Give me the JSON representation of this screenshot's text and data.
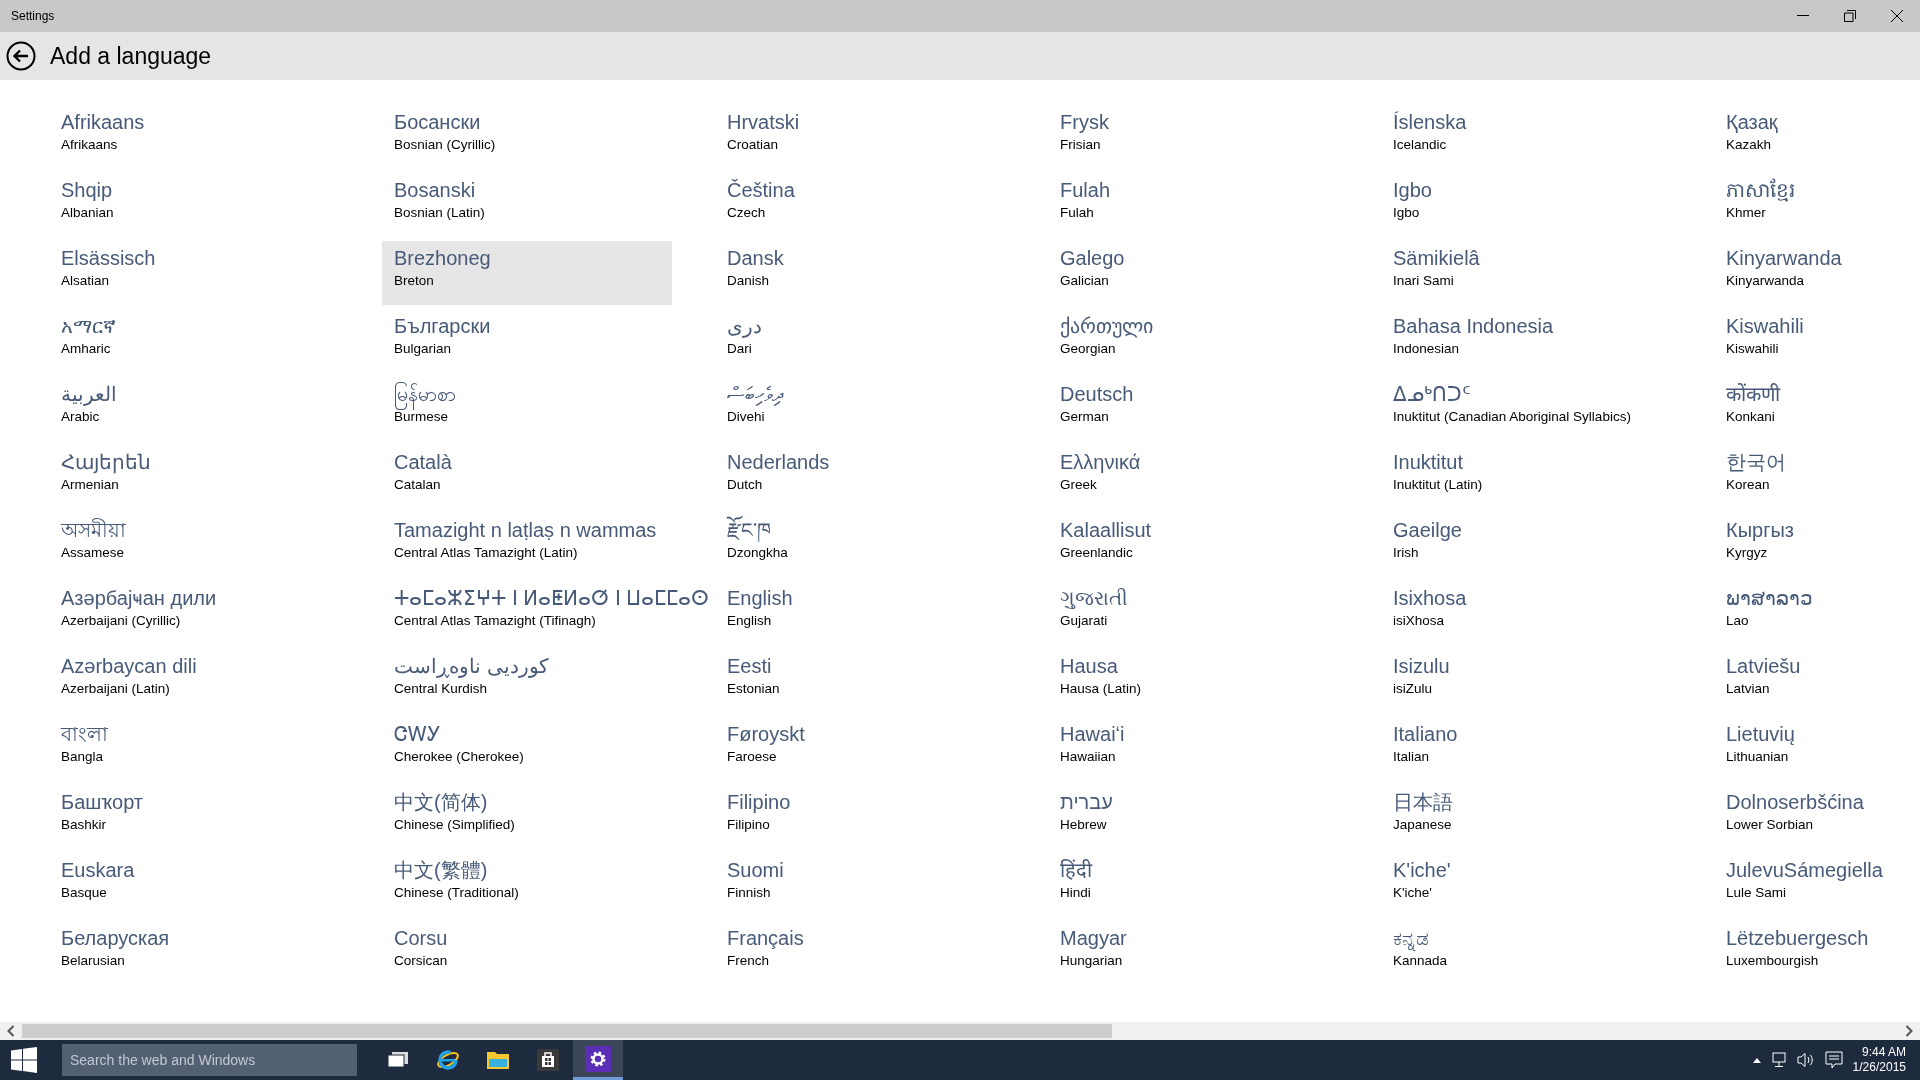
{
  "window": {
    "title": "Settings"
  },
  "page": {
    "title": "Add a language"
  },
  "languages": [
    {
      "native": "Afrikaans",
      "english": "Afrikaans",
      "selected": false
    },
    {
      "native": "Shqip",
      "english": "Albanian",
      "selected": false
    },
    {
      "native": "Elsässisch",
      "english": "Alsatian",
      "selected": false
    },
    {
      "native": "አማርኛ",
      "english": "Amharic",
      "selected": false
    },
    {
      "native": "العربية",
      "english": "Arabic",
      "selected": false
    },
    {
      "native": "Հայերեն",
      "english": "Armenian",
      "selected": false
    },
    {
      "native": "অসমীয়া",
      "english": "Assamese",
      "selected": false
    },
    {
      "native": "Азәрбајҹан дили",
      "english": "Azerbaijani (Cyrillic)",
      "selected": false
    },
    {
      "native": "Azərbaycan dili",
      "english": "Azerbaijani (Latin)",
      "selected": false
    },
    {
      "native": "বাংলা",
      "english": "Bangla",
      "selected": false
    },
    {
      "native": "Башҡорт",
      "english": "Bashkir",
      "selected": false
    },
    {
      "native": "Euskara",
      "english": "Basque",
      "selected": false
    },
    {
      "native": "Беларуская",
      "english": "Belarusian",
      "selected": false
    },
    {
      "native": "Босански",
      "english": "Bosnian (Cyrillic)",
      "selected": false
    },
    {
      "native": "Bosanski",
      "english": "Bosnian (Latin)",
      "selected": false
    },
    {
      "native": "Brezhoneg",
      "english": "Breton",
      "selected": true
    },
    {
      "native": "Български",
      "english": "Bulgarian",
      "selected": false
    },
    {
      "native": "မြန်မာစာ",
      "english": "Burmese",
      "selected": false
    },
    {
      "native": "Català",
      "english": "Catalan",
      "selected": false
    },
    {
      "native": "Tamazight n laṭlaṣ n wammas",
      "english": "Central Atlas Tamazight (Latin)",
      "selected": false
    },
    {
      "native": "ⵜⴰⵎⴰⵣⵉⵖⵜ ⵏ ⵍⴰⵟⵍⴰⵚ ⵏ ⵡⴰⵎⵎⴰⵙ",
      "english": "Central Atlas Tamazight (Tifinagh)",
      "selected": false
    },
    {
      "native": "کوردیی ناوەڕاست",
      "english": "Central Kurdish",
      "selected": false
    },
    {
      "native": "ᏣᎳᎩ",
      "english": "Cherokee (Cherokee)",
      "selected": false
    },
    {
      "native": "中文(简体)",
      "english": "Chinese (Simplified)",
      "selected": false
    },
    {
      "native": "中文(繁體)",
      "english": "Chinese (Traditional)",
      "selected": false
    },
    {
      "native": "Corsu",
      "english": "Corsican",
      "selected": false
    },
    {
      "native": "Hrvatski",
      "english": "Croatian",
      "selected": false
    },
    {
      "native": "Čeština",
      "english": "Czech",
      "selected": false
    },
    {
      "native": "Dansk",
      "english": "Danish",
      "selected": false
    },
    {
      "native": "دری",
      "english": "Dari",
      "selected": false
    },
    {
      "native": "ދިވެހިބަސް",
      "english": "Divehi",
      "selected": false
    },
    {
      "native": "Nederlands",
      "english": "Dutch",
      "selected": false
    },
    {
      "native": "རྫོང་ཁ",
      "english": "Dzongkha",
      "selected": false
    },
    {
      "native": "English",
      "english": "English",
      "selected": false
    },
    {
      "native": "Eesti",
      "english": "Estonian",
      "selected": false
    },
    {
      "native": "Føroyskt",
      "english": "Faroese",
      "selected": false
    },
    {
      "native": "Filipino",
      "english": "Filipino",
      "selected": false
    },
    {
      "native": "Suomi",
      "english": "Finnish",
      "selected": false
    },
    {
      "native": "Français",
      "english": "French",
      "selected": false
    },
    {
      "native": "Frysk",
      "english": "Frisian",
      "selected": false
    },
    {
      "native": "Fulah",
      "english": "Fulah",
      "selected": false
    },
    {
      "native": "Galego",
      "english": "Galician",
      "selected": false
    },
    {
      "native": "ქართული",
      "english": "Georgian",
      "selected": false
    },
    {
      "native": "Deutsch",
      "english": "German",
      "selected": false
    },
    {
      "native": "Ελληνικά",
      "english": "Greek",
      "selected": false
    },
    {
      "native": "Kalaallisut",
      "english": "Greenlandic",
      "selected": false
    },
    {
      "native": "ગુજરાતી",
      "english": "Gujarati",
      "selected": false
    },
    {
      "native": "Hausa",
      "english": "Hausa (Latin)",
      "selected": false
    },
    {
      "native": "Hawaiʻi",
      "english": "Hawaiian",
      "selected": false
    },
    {
      "native": "עברית",
      "english": "Hebrew",
      "selected": false
    },
    {
      "native": "हिंदी",
      "english": "Hindi",
      "selected": false
    },
    {
      "native": "Magyar",
      "english": "Hungarian",
      "selected": false
    },
    {
      "native": "Íslenska",
      "english": "Icelandic",
      "selected": false
    },
    {
      "native": "Igbo",
      "english": "Igbo",
      "selected": false
    },
    {
      "native": "Sämikielâ",
      "english": "Inari Sami",
      "selected": false
    },
    {
      "native": "Bahasa Indonesia",
      "english": "Indonesian",
      "selected": false
    },
    {
      "native": "ᐃᓄᒃᑎᑐᑦ",
      "english": "Inuktitut (Canadian Aboriginal Syllabics)",
      "selected": false
    },
    {
      "native": "Inuktitut",
      "english": "Inuktitut (Latin)",
      "selected": false
    },
    {
      "native": "Gaeilge",
      "english": "Irish",
      "selected": false
    },
    {
      "native": "Isixhosa",
      "english": "isiXhosa",
      "selected": false
    },
    {
      "native": "Isizulu",
      "english": "isiZulu",
      "selected": false
    },
    {
      "native": "Italiano",
      "english": "Italian",
      "selected": false
    },
    {
      "native": "日本語",
      "english": "Japanese",
      "selected": false
    },
    {
      "native": "K'iche'",
      "english": "K'iche'",
      "selected": false
    },
    {
      "native": "ಕನ್ನಡ",
      "english": "Kannada",
      "selected": false
    },
    {
      "native": "Қазақ",
      "english": "Kazakh",
      "selected": false
    },
    {
      "native": "ភាសាខ្មែរ",
      "english": "Khmer",
      "selected": false
    },
    {
      "native": "Kinyarwanda",
      "english": "Kinyarwanda",
      "selected": false
    },
    {
      "native": "Kiswahili",
      "english": "Kiswahili",
      "selected": false
    },
    {
      "native": "कोंकणी",
      "english": "Konkani",
      "selected": false
    },
    {
      "native": "한국어",
      "english": "Korean",
      "selected": false
    },
    {
      "native": "Кыргыз",
      "english": "Kyrgyz",
      "selected": false
    },
    {
      "native": "ພາສາລາວ",
      "english": "Lao",
      "selected": false
    },
    {
      "native": "Latviešu",
      "english": "Latvian",
      "selected": false
    },
    {
      "native": "Lietuvių",
      "english": "Lithuanian",
      "selected": false
    },
    {
      "native": "Dolnoserbšćina",
      "english": "Lower Sorbian",
      "selected": false
    },
    {
      "native": "JulevuSámegiella",
      "english": "Lule Sami",
      "selected": false
    },
    {
      "native": "Lëtzebuergesch",
      "english": "Luxembourgish",
      "selected": false
    }
  ],
  "taskbar": {
    "search": {
      "placeholder": "Search the web and Windows"
    },
    "apps": [
      {
        "kind": "taskview",
        "selected": false
      },
      {
        "kind": "browser",
        "selected": false
      },
      {
        "kind": "folder",
        "selected": false
      },
      {
        "kind": "store",
        "selected": false
      },
      {
        "kind": "settings",
        "selected": true
      }
    ],
    "clock": {
      "time": "9:44 AM",
      "date": "1/26/2015"
    }
  }
}
